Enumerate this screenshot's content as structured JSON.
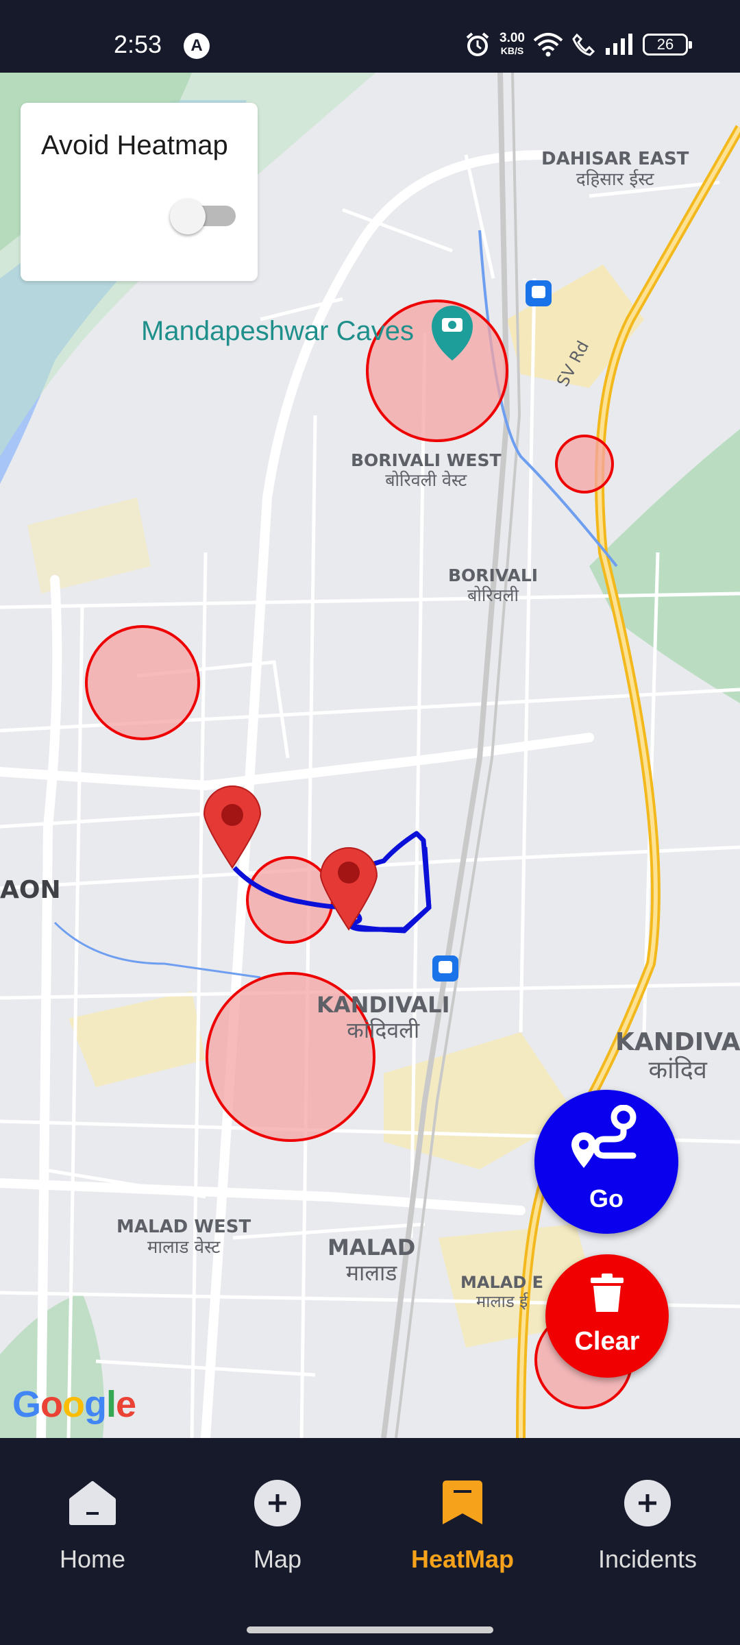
{
  "status_bar": {
    "time": "2:53",
    "notification_letter": "A",
    "speed_value": "3.00",
    "speed_unit": "KB/S",
    "battery": "26",
    "icons": [
      "alarm-icon",
      "wifi-icon",
      "call-icon",
      "signal-icon",
      "battery-icon"
    ]
  },
  "map": {
    "poi": "Mandapeshwar Caves",
    "labels": {
      "dahisar_east": "DAHISAR EAST",
      "dahisar_east_hi": "दहिसार ईस्ट",
      "sv_rd": "SV Rd",
      "borivali_west": "BORIVALI WEST",
      "borivali_west_hi": "बोरिवली वेस्ट",
      "borivali": "BORIVALI",
      "borivali_hi": "बोरिवली",
      "aon": "AON",
      "kandivali": "KANDIVALI",
      "kandivali_hi": "कांदिवली",
      "kandivali_right": "KANDIVA",
      "kandivali_right_hi": "कांदिव",
      "malad_west": "MALAD WEST",
      "malad_west_hi": "मालाड वेस्ट",
      "malad": "MALAD",
      "malad_hi": "मालाड",
      "malad_e": "MALAD E",
      "malad_e_hi": "मालाड ई"
    },
    "google": "Google",
    "colors": {
      "heat_fill": "#f4a4a4",
      "heat_stroke": "#ee0000",
      "route": "#0a10d8",
      "marker": "#e53935"
    }
  },
  "avoid_heatmap": {
    "title": "Avoid Heatmap",
    "enabled": false
  },
  "actions": {
    "go_label": "Go",
    "clear_label": "Clear"
  },
  "bottom_nav": {
    "items": [
      {
        "label": "Home",
        "icon": "home-icon",
        "active": false
      },
      {
        "label": "Map",
        "icon": "plus-icon",
        "active": false
      },
      {
        "label": "HeatMap",
        "icon": "bookmark-icon",
        "active": true
      },
      {
        "label": "Incidents",
        "icon": "plus-icon",
        "active": false
      }
    ],
    "active_color": "#f7a21b"
  }
}
